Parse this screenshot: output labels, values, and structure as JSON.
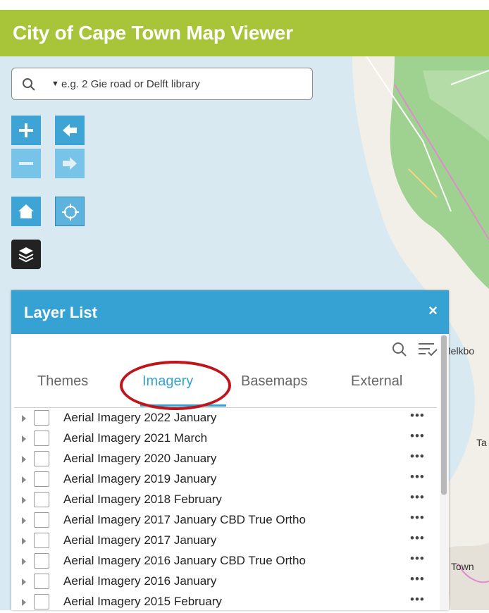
{
  "header": {
    "title": "City of Cape Town Map Viewer"
  },
  "search": {
    "placeholder": "e.g. 2 Gie road or Delft library"
  },
  "map_labels": {
    "melkbos": "Melkbo",
    "ta": "Ta",
    "town": "Town"
  },
  "layer_list": {
    "title": "Layer List",
    "close_label": "×",
    "tabs": [
      {
        "label": "Themes"
      },
      {
        "label": "Imagery"
      },
      {
        "label": "Basemaps"
      },
      {
        "label": "External"
      }
    ],
    "active_tab": "Imagery",
    "more_label": "•••",
    "layers": [
      {
        "label": "Aerial Imagery 2022 January"
      },
      {
        "label": "Aerial Imagery 2021 March"
      },
      {
        "label": "Aerial Imagery 2020 January"
      },
      {
        "label": "Aerial Imagery 2019 January"
      },
      {
        "label": "Aerial Imagery 2018 February"
      },
      {
        "label": "Aerial Imagery 2017 January CBD True Ortho"
      },
      {
        "label": "Aerial Imagery 2017 January"
      },
      {
        "label": "Aerial Imagery 2016 January CBD True Ortho"
      },
      {
        "label": "Aerial Imagery 2016 January"
      },
      {
        "label": "Aerial Imagery 2015 February"
      }
    ]
  },
  "colors": {
    "header_bg": "#a8c53a",
    "accent_blue": "#36a2d3",
    "highlight_circle": "#c0141b",
    "water": "#d8e9f2",
    "green_area": "#9fd290"
  },
  "icons": {
    "search": "search-icon",
    "zoom_in": "plus-icon",
    "zoom_out": "minus-icon",
    "back": "arrow-left-icon",
    "forward": "arrow-right-icon",
    "home": "home-icon",
    "locate": "locate-icon",
    "layers": "layers-icon",
    "filter": "filter-icon"
  }
}
